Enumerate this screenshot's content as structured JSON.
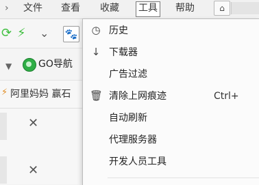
{
  "menubar": {
    "items": [
      {
        "label": "文件"
      },
      {
        "label": "查看"
      },
      {
        "label": "收藏"
      },
      {
        "label": "工具"
      },
      {
        "label": "帮助"
      }
    ]
  },
  "toolbar": {
    "go_label": "GO导航"
  },
  "bookmarks": {
    "text": "阿里妈妈 赢石"
  },
  "tools_menu": {
    "items": [
      {
        "label": "历史",
        "icon": "clock-icon"
      },
      {
        "label": "下载器",
        "icon": "download-arrow-icon"
      },
      {
        "label": "广告过滤"
      },
      {
        "label": "清除上网痕迹",
        "icon": "trash-icon",
        "shortcut": "Ctrl+"
      },
      {
        "label": "自动刷新"
      },
      {
        "label": "代理服务器"
      },
      {
        "label": "开发人员工具"
      }
    ]
  },
  "colors": {
    "menu_bg": "#f1f1f1",
    "dropdown_bg": "#fbfbfb",
    "go_green": "#2fae46",
    "paw_blue": "#1a3fc0",
    "bolt_green": "#3fbf3f"
  }
}
